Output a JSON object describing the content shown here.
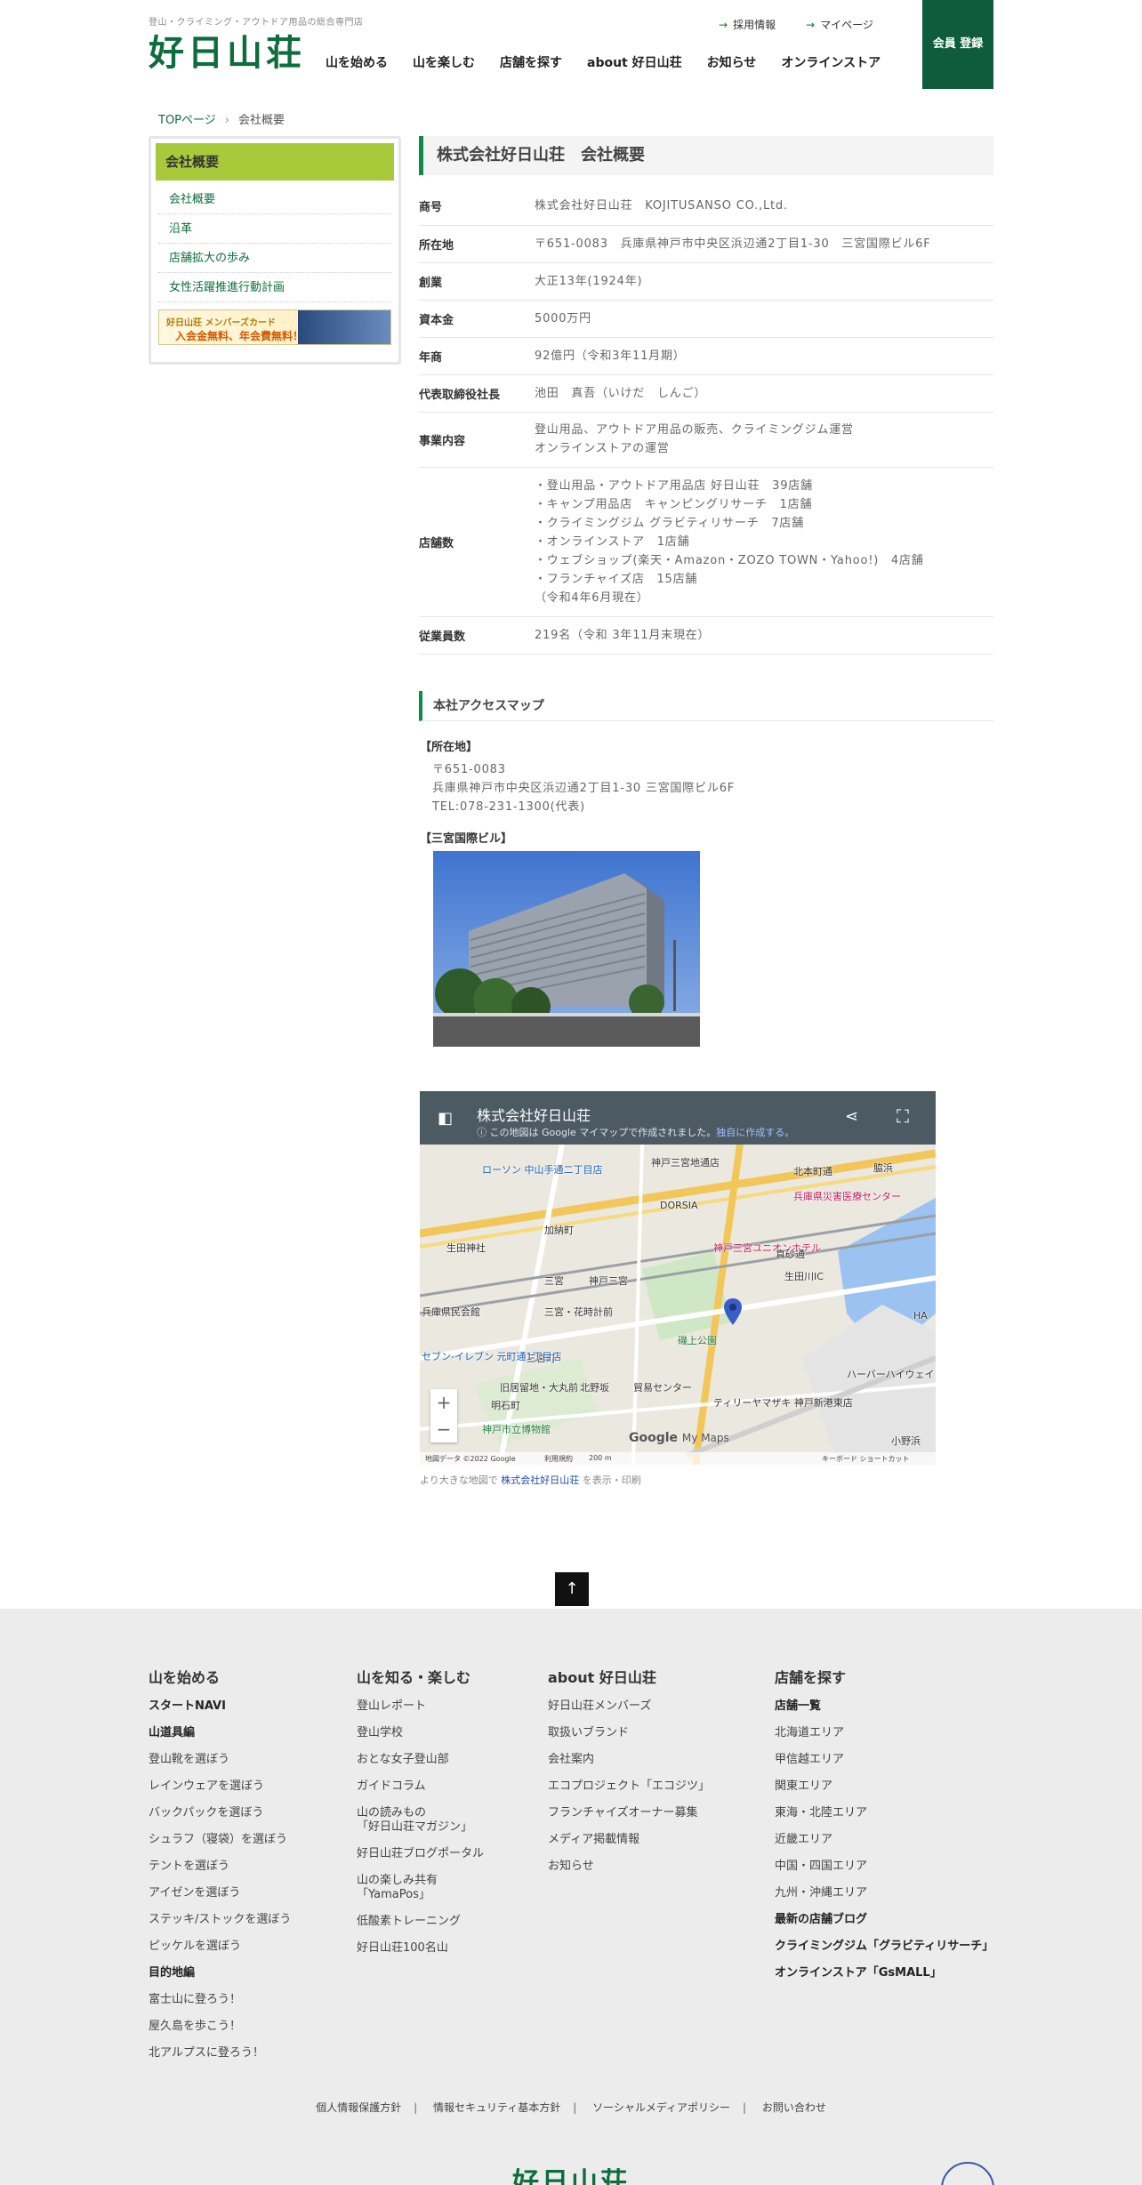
{
  "header": {
    "tagline": "登山・クライミング・アウトドア用品の総合専門店",
    "logo": "好日山荘",
    "util_links": [
      "採用情報",
      "マイページ"
    ],
    "nav": [
      "山を始める",
      "山を楽しむ",
      "店舗を探す",
      "about 好日山荘",
      "お知らせ",
      "オンラインストア"
    ],
    "register": "会員 登録"
  },
  "breadcrumb": {
    "home": "TOPページ",
    "current": "会社概要"
  },
  "sidebar": {
    "title": "会社概要",
    "items": [
      "会社概要",
      "沿革",
      "店舗拡大の歩み",
      "女性活躍推進行動計画"
    ],
    "banner_line1": "好日山荘 メンバーズカード",
    "banner_line2": "入会金無料、年会費無料！"
  },
  "main": {
    "title": "株式会社好日山荘　会社概要",
    "rows": [
      {
        "label": "商号",
        "lines": [
          "株式会社好日山荘　KOJITUSANSO CO.,Ltd."
        ]
      },
      {
        "label": "所在地",
        "lines": [
          "〒651-0083　兵庫県神戸市中央区浜辺通2丁目1-30　三宮国際ビル6F"
        ]
      },
      {
        "label": "創業",
        "lines": [
          "大正13年(1924年)"
        ]
      },
      {
        "label": "資本金",
        "lines": [
          "5000万円"
        ]
      },
      {
        "label": "年商",
        "lines": [
          "92億円（令和3年11月期）"
        ]
      },
      {
        "label": "代表取締役社長",
        "lines": [
          "池田　真吾（いけだ　しんご）"
        ]
      },
      {
        "label": "事業内容",
        "lines": [
          "登山用品、アウトドア用品の販売、クライミングジム運営",
          "オンラインストアの運営"
        ]
      },
      {
        "label": "店舗数",
        "lines": [
          "・登山用品・アウトドア用品店 好日山荘　39店舗",
          "・キャンプ用品店　キャンピングリサーチ　1店舗",
          "・クライミングジム グラビティリサーチ　7店舗",
          "・オンラインストア　1店舗",
          "・ウェブショップ(楽天・Amazon・ZOZO TOWN・Yahoo!)　4店舗",
          "・フランチャイズ店　15店舗",
          "（令和4年6月現在）"
        ]
      },
      {
        "label": "従業員数",
        "lines": [
          "219名（令和 3年11月末現在）"
        ]
      }
    ]
  },
  "access": {
    "heading": "本社アクセスマップ",
    "address_label": "【所在地】",
    "address_lines": [
      "〒651-0083",
      "兵庫県神戸市中央区浜辺通2丁目1-30 三宮国際ビル6F",
      "TEL:078-231-1300(代表)"
    ],
    "building_label": "【三宮国際ビル】"
  },
  "map": {
    "title": "株式会社好日山荘",
    "subtitle": "この地図は Google マイマップで作成されました。",
    "subtitle_link": "独自に作成する。",
    "labels": [
      "ローソン 中山手通二丁目店",
      "神戸三宮地通店",
      "北本町通",
      "脇浜",
      "兵庫県災害医療センター",
      "DORSIA",
      "加納町",
      "生田神社",
      "神戸三宮ユニオンホテル",
      "真砂通",
      "生田川IC",
      "三宮",
      "神戸三宮",
      "兵庫県民会館",
      "三宮・花時計前",
      "磯上公園",
      "三宮町",
      "セブン-イレブン 元町通1丁目店",
      "旧居留地・大丸前",
      "北野坂",
      "明石町",
      "貿易センター",
      "ティリーヤマザキ 神戸新港東店",
      "ハーバーハイウェイ",
      "神戸市立博物館",
      "小野浜",
      "HA"
    ],
    "footer_credit": "地図データ ©2022 Google",
    "footer_terms": "利用規約",
    "scale": "200 m",
    "keyboard": "キーボード ショートカット",
    "mymaps": "My Maps"
  },
  "map_caption": {
    "before": "より大きな地図で",
    "link": "株式会社好日山荘",
    "after": "を表示・印刷"
  },
  "footer": {
    "col1": {
      "title": "山を始める",
      "items": [
        {
          "t": "スタートNAVI",
          "b": true
        },
        {
          "t": "山道具編",
          "b": true
        },
        {
          "t": "登山靴を選ぼう"
        },
        {
          "t": "レインウェアを選ぼう"
        },
        {
          "t": "バックパックを選ぼう"
        },
        {
          "t": "シュラフ（寝袋）を選ぼう"
        },
        {
          "t": "テントを選ぼう"
        },
        {
          "t": "アイゼンを選ぼう"
        },
        {
          "t": "ステッキ/ストックを選ぼう"
        },
        {
          "t": "ピッケルを選ぼう"
        },
        {
          "t": "目的地編",
          "b": true
        },
        {
          "t": "富士山に登ろう！"
        },
        {
          "t": "屋久島を歩こう！"
        },
        {
          "t": "北アルプスに登ろう！"
        }
      ]
    },
    "col2": {
      "title": "山を知る・楽しむ",
      "items": [
        {
          "t": "登山レポート"
        },
        {
          "t": "登山学校"
        },
        {
          "t": "おとな女子登山部"
        },
        {
          "t": "ガイドコラム"
        },
        {
          "t": "山の読みもの",
          "t2": "「好日山荘マガジン」"
        },
        {
          "t": "好日山荘ブログポータル"
        },
        {
          "t": "山の楽しみ共有",
          "t2": "「YamaPos」"
        },
        {
          "t": "低酸素トレーニング"
        },
        {
          "t": "好日山荘100名山"
        }
      ]
    },
    "col3": {
      "title": "about 好日山荘",
      "items": [
        {
          "t": "好日山荘メンバーズ"
        },
        {
          "t": "取扱いブランド"
        },
        {
          "t": "会社案内"
        },
        {
          "t": "エコプロジェクト「エコジツ」"
        },
        {
          "t": "フランチャイズオーナー募集"
        },
        {
          "t": "メディア掲載情報"
        },
        {
          "t": "お知らせ"
        }
      ]
    },
    "col4": {
      "title": "店舗を探す",
      "items": [
        {
          "t": "店舗一覧",
          "b": true
        },
        {
          "t": "北海道エリア"
        },
        {
          "t": "甲信越エリア"
        },
        {
          "t": "関東エリア"
        },
        {
          "t": "東海・北陸エリア"
        },
        {
          "t": "近畿エリア"
        },
        {
          "t": "中国・四国エリア"
        },
        {
          "t": "九州・沖縄エリア"
        },
        {
          "t": "最新の店舗ブログ",
          "b": true
        },
        {
          "t": "クライミングジム「グラビティリサーチ」",
          "b": true
        },
        {
          "t": "オンラインストア「GsMALL」",
          "b": true
        }
      ]
    },
    "bottom_links": [
      "個人情報保護方針",
      "情報セキュリティ基本方針",
      "ソーシャルメディアポリシー",
      "お問い合わせ"
    ],
    "logo": "好日山荘"
  },
  "colors": {
    "brand_green": "#0e6d3c",
    "sidebar_green": "#a8c939",
    "footer_bg": "#ececec",
    "map_bar": "#4c5a64"
  },
  "icons": [
    "arrow-right-icon",
    "chevron-right-icon",
    "info-icon",
    "share-icon",
    "fullscreen-icon",
    "layers-icon",
    "zoom-in-icon",
    "zoom-out-icon",
    "map-pin-icon",
    "to-top-icon"
  ]
}
